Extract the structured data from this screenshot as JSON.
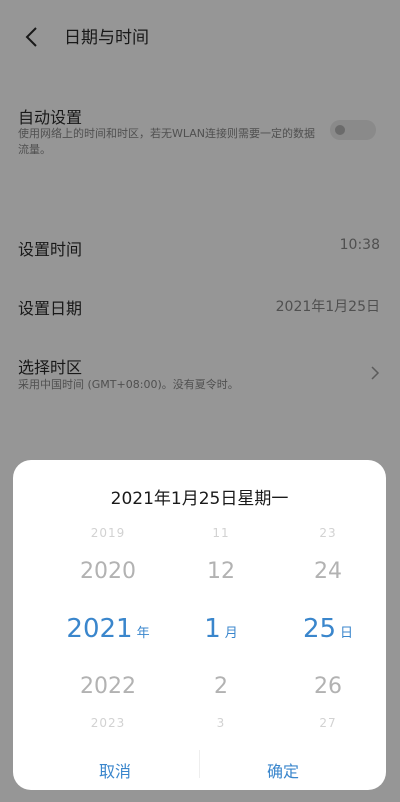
{
  "header": {
    "title": "日期与时间"
  },
  "settings": {
    "auto": {
      "label": "自动设置",
      "description": "使用网络上的时间和时区，若无WLAN连接则需要一定的数据流量。",
      "enabled": false
    },
    "set_time": {
      "label": "设置时间",
      "value": "10:38"
    },
    "set_date": {
      "label": "设置日期",
      "value": "2021年1月25日"
    },
    "timezone": {
      "label": "选择时区",
      "description": "采用中国时间 (GMT+08:00)。没有夏令时。"
    }
  },
  "picker": {
    "title": "2021年1月25日星期一",
    "year": {
      "above_far": "2019",
      "above": "2020",
      "selected": "2021",
      "below": "2022",
      "below_far": "2023",
      "unit": "年"
    },
    "month": {
      "above_far": "11",
      "above": "12",
      "selected": "1",
      "below": "2",
      "below_far": "3",
      "unit": "月"
    },
    "day": {
      "above_far": "23",
      "above": "24",
      "selected": "25",
      "below": "26",
      "below_far": "27",
      "unit": "日"
    },
    "cancel_label": "取消",
    "ok_label": "确定"
  },
  "colors": {
    "accent": "#3a86cc"
  }
}
